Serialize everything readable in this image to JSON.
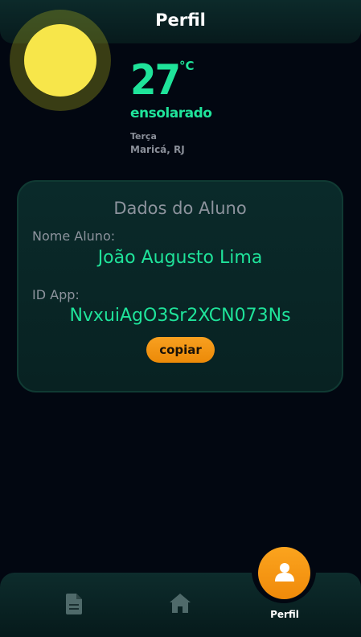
{
  "header": {
    "title": "Perfil"
  },
  "weather": {
    "temperature": "27",
    "unit": "°C",
    "condition": "ensolarado",
    "day": "Terça",
    "location": "Maricá, RJ"
  },
  "student_card": {
    "title": "Dados do Aluno",
    "name_label": "Nome Aluno:",
    "name_value": "João Augusto Lima",
    "id_label": "ID App:",
    "id_value": "NvxuiAgO3Sr2XCN073Ns",
    "copy_button": "copiar"
  },
  "bottom_nav": {
    "items": [
      {
        "icon": "document-icon"
      },
      {
        "icon": "home-icon"
      },
      {
        "icon": "user-icon",
        "label": "Perfil",
        "active": true
      }
    ]
  },
  "colors": {
    "accent": "#1fe39a",
    "button": "#f59a14",
    "background": "#020711"
  }
}
